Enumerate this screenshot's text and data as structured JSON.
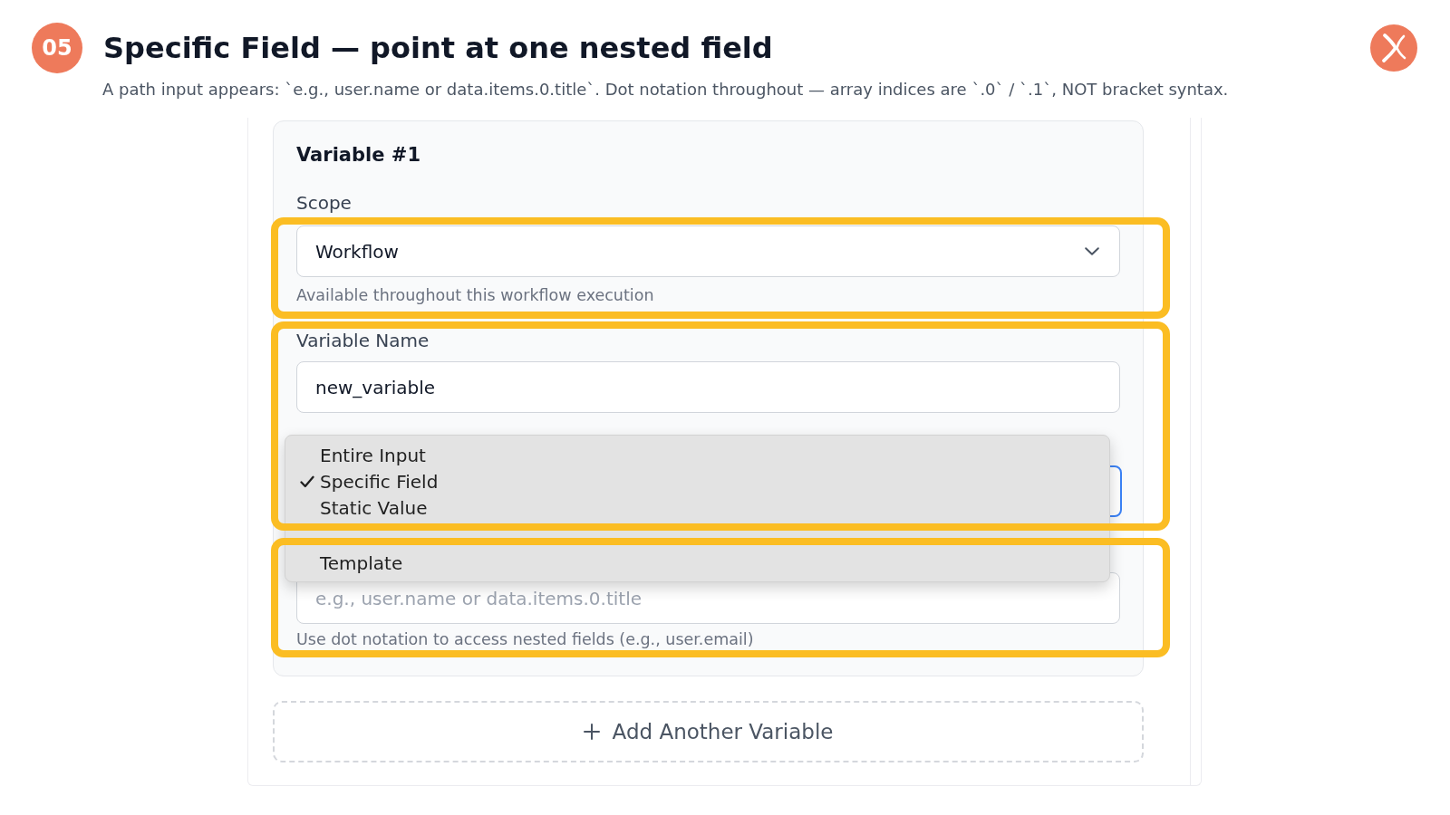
{
  "header": {
    "step": "05",
    "title": "Specific Field — point at one nested field",
    "subtitle": "A path input appears: `e.g., user.name or data.items.0.title`. Dot notation throughout — array indices are `.0` / `.1`, NOT bracket syntax."
  },
  "panel": {
    "variable_card": {
      "heading": "Variable #1",
      "scope_label": "Scope",
      "groups": [
        {
          "kind": "scope",
          "highlighted": true,
          "select_value": "Workflow",
          "hint": "Available throughout this workflow execution"
        },
        {
          "kind": "name_source",
          "highlighted": true,
          "label": "Variable Name",
          "value": "new_variable",
          "source_select": {
            "focused": true,
            "open": true,
            "options": [
              {
                "label": "Entire Input",
                "selected": false
              },
              {
                "label": "Specific Field",
                "selected": true
              },
              {
                "label": "Static Value",
                "selected": false
              },
              {
                "label": "Template",
                "selected": false
              }
            ]
          }
        },
        {
          "kind": "path",
          "highlighted": true,
          "placeholder": "e.g., user.name or data.items.0.title",
          "hint": "Use dot notation to access nested fields (e.g., user.email)"
        }
      ]
    },
    "add_button": "Add Another Variable"
  }
}
